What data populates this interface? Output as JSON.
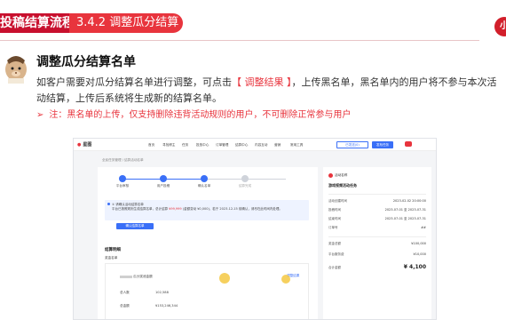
{
  "header": {
    "chapter_title": "投稿结算流程",
    "section_number": "3.4.2",
    "section_title": "调整瓜分结算名单",
    "logo_text": "小"
  },
  "content": {
    "heading": "调整瓜分结算名单",
    "desc_part1": "如客户需要对瓜分结算名单进行调整，可点击",
    "desc_highlight": "【 调整结果 】",
    "desc_part2": "，上传黑名单，黑名单内的用户将不参与本次活动结算，上传后系统将生成新的结算名单。",
    "note_arrow": "➢",
    "note_text": "注：黑名单的上传，仅支持删除违背活动规则的用户，不可删除正常参与用户"
  },
  "screenshot": {
    "app_name": "星图",
    "nav_items": [
      "首页",
      "寻找博主",
      "任务",
      "投放中心",
      "订单管理",
      "结算中心",
      "内容互动",
      "营销",
      "常用工具"
    ],
    "btn_outline": "已发送(0)",
    "btn_solid": "发布任务",
    "breadcrumb": "全民任务管理 / 结算活动名单",
    "steps": [
      "平台审核",
      "用户投稿",
      "确认名单",
      "结算完成"
    ],
    "alert_title": "① 请确认活动结算名单",
    "alert_text_1": "平台已按照规则生成结算名单，总计结算 ",
    "alert_amount": "¥99,999",
    "alert_text_2": " (金额变动 ¥0,000)，若于 2023-12-15 前确认，请尽在此时间内处理。",
    "alert_button": "确认结算名单",
    "result_title": "结算明细",
    "result_subtitle": "奖金名单",
    "result_name_label": "瓜分奖池金额",
    "result_rows": [
      {
        "label": "总人数",
        "value": "102,588"
      },
      {
        "label": "总金额",
        "value": "¥153,246,344"
      }
    ],
    "adjust_link": "调整结果",
    "right_badge": "活动名称",
    "right_title": "游戏视频活动任务",
    "right_rows": [
      {
        "label": "活动创建时间",
        "value": "2023-02-02 20:00:00"
      },
      {
        "label": "投稿时间",
        "value": "2023-07-01 至 2023-07-31"
      },
      {
        "label": "结束时间",
        "value": "2023-07-01 至 2023-07-31"
      },
      {
        "label": "订单号",
        "value": "##"
      }
    ],
    "right_amounts": [
      {
        "label": "奖金总额",
        "value": "¥100,000"
      },
      {
        "label": "平台服务费",
        "value": "¥10,000"
      }
    ],
    "right_total_label": "合计金额",
    "right_total": "¥ 4,100"
  }
}
